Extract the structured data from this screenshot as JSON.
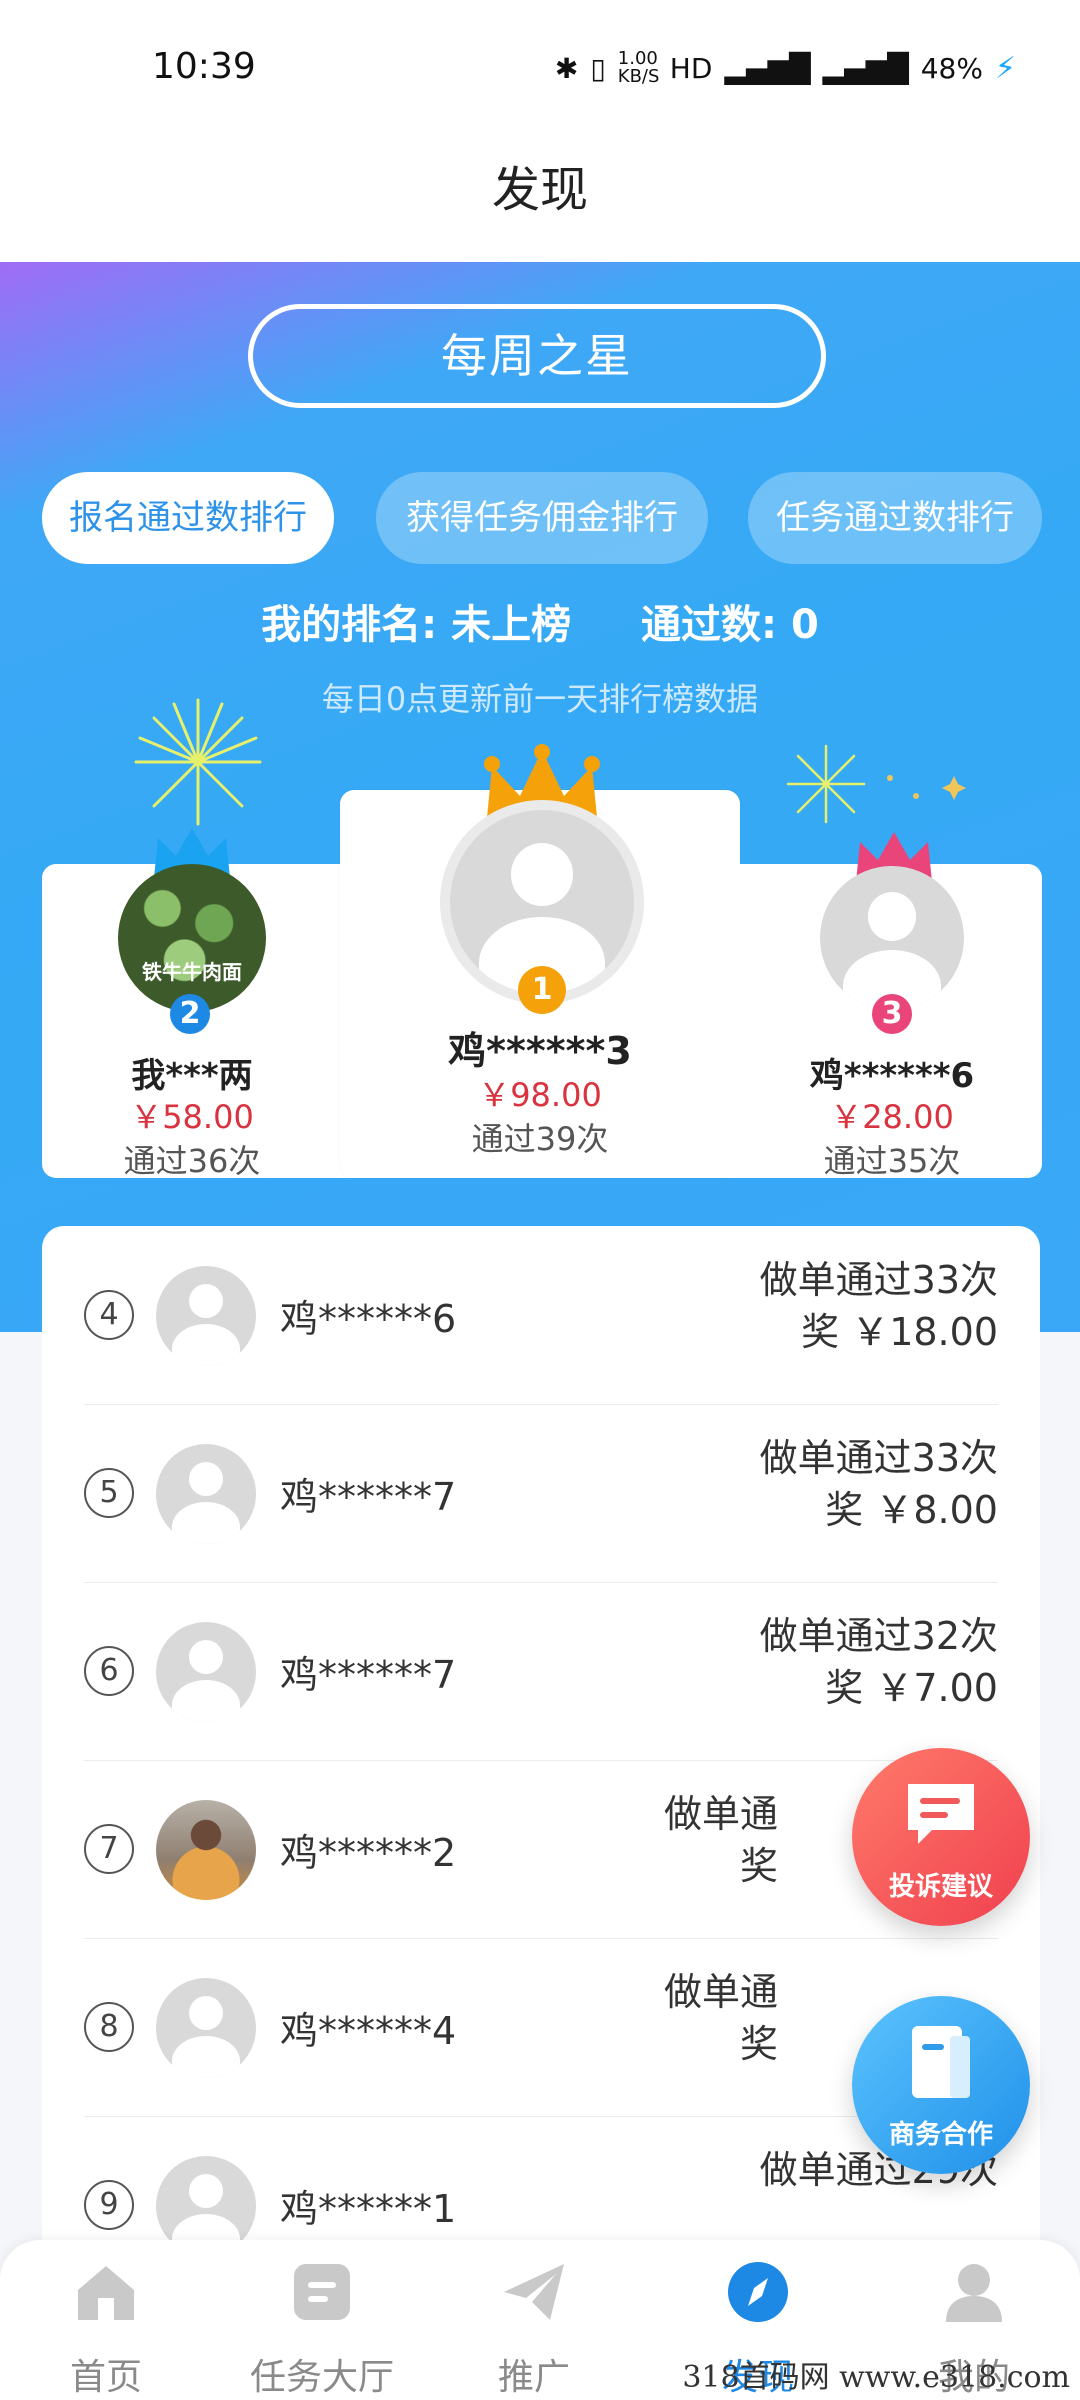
{
  "status": {
    "time": "10:39",
    "speed": "1.00 KB/S",
    "net1": "HD",
    "net2": "4G",
    "net3": "4G",
    "battery": "48%"
  },
  "header": {
    "title": "发现"
  },
  "hero": {
    "star_title": "每周之星",
    "tabs": [
      "报名通过数排行",
      "获得任务佣金排行",
      "任务通过数排行"
    ],
    "my_rank_label": "我的排名: 未上榜",
    "my_pass_label": "通过数: 0",
    "update_note": "每日0点更新前一天排行榜数据"
  },
  "podium": {
    "first": {
      "rank": "1",
      "name": "鸡******3",
      "prize": "￥98.00",
      "pass": "通过39次"
    },
    "second": {
      "rank": "2",
      "name": "我***两",
      "prize": "￥58.00",
      "pass": "通过36次",
      "avatar_text": "铁牛牛肉面"
    },
    "third": {
      "rank": "3",
      "name": "鸡******6",
      "prize": "￥28.00",
      "pass": "通过35次"
    }
  },
  "list": [
    {
      "rank": "4",
      "name": "鸡******6",
      "line1": "做单通过33次",
      "line2": "奖 ￥18.00"
    },
    {
      "rank": "5",
      "name": "鸡******7",
      "line1": "做单通过33次",
      "line2": "奖 ￥8.00"
    },
    {
      "rank": "6",
      "name": "鸡******7",
      "line1": "做单通过32次",
      "line2": "奖 ￥7.00"
    },
    {
      "rank": "7",
      "name": "鸡******2",
      "line1": "做单通",
      "line2": "奖"
    },
    {
      "rank": "8",
      "name": "鸡******4",
      "line1": "做单通",
      "line2": "奖"
    },
    {
      "rank": "9",
      "name": "鸡******1",
      "line1": "做单通过29次",
      "line2": ""
    }
  ],
  "floating": {
    "complaint": "投诉建议",
    "business": "商务合作"
  },
  "tabbar": [
    "首页",
    "任务大厅",
    "推广",
    "发现",
    "我的"
  ],
  "watermark": "318首码网 www.e318.com",
  "colors": {
    "primary": "#1e88e5",
    "prize": "#d9333f",
    "gold": "#f5a20a",
    "pink": "#e9457a"
  }
}
